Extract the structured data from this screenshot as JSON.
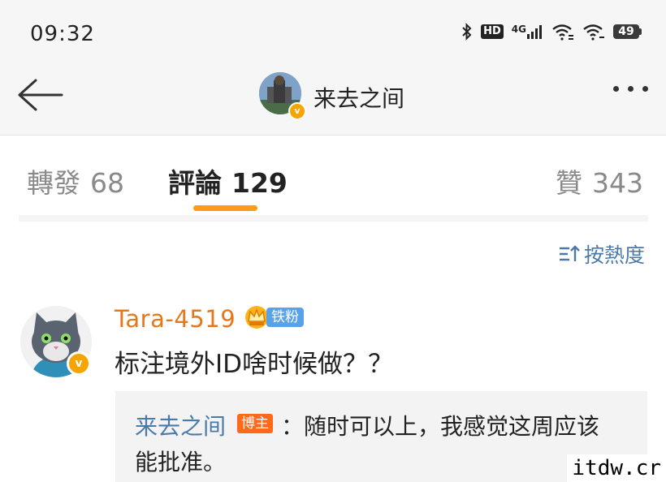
{
  "status_bar": {
    "time": "09:32",
    "hd": "HD",
    "network": "4G",
    "battery": "49"
  },
  "header": {
    "title": "来去之间"
  },
  "tabs": [
    {
      "label": "轉發",
      "count": "68"
    },
    {
      "label": "評論",
      "count": "129"
    },
    {
      "label": "贊",
      "count": "343"
    }
  ],
  "sort": {
    "label": "按熱度"
  },
  "comment": {
    "username": "Tara-4519",
    "fan_badge": "铁粉",
    "text": "标注境外ID啥时候做？？",
    "reply": {
      "author": "来去之间",
      "author_badge": "博主",
      "line1": "：随时可以上，我感觉这周应该",
      "line2": "能批准。"
    }
  },
  "watermark": "itdw.cr",
  "colors": {
    "accent": "#ff9a1a",
    "link": "#4a7aab",
    "username": "#e8771a",
    "fan_badge": "#5aa2e8",
    "author_badge": "#ff6a1a"
  }
}
